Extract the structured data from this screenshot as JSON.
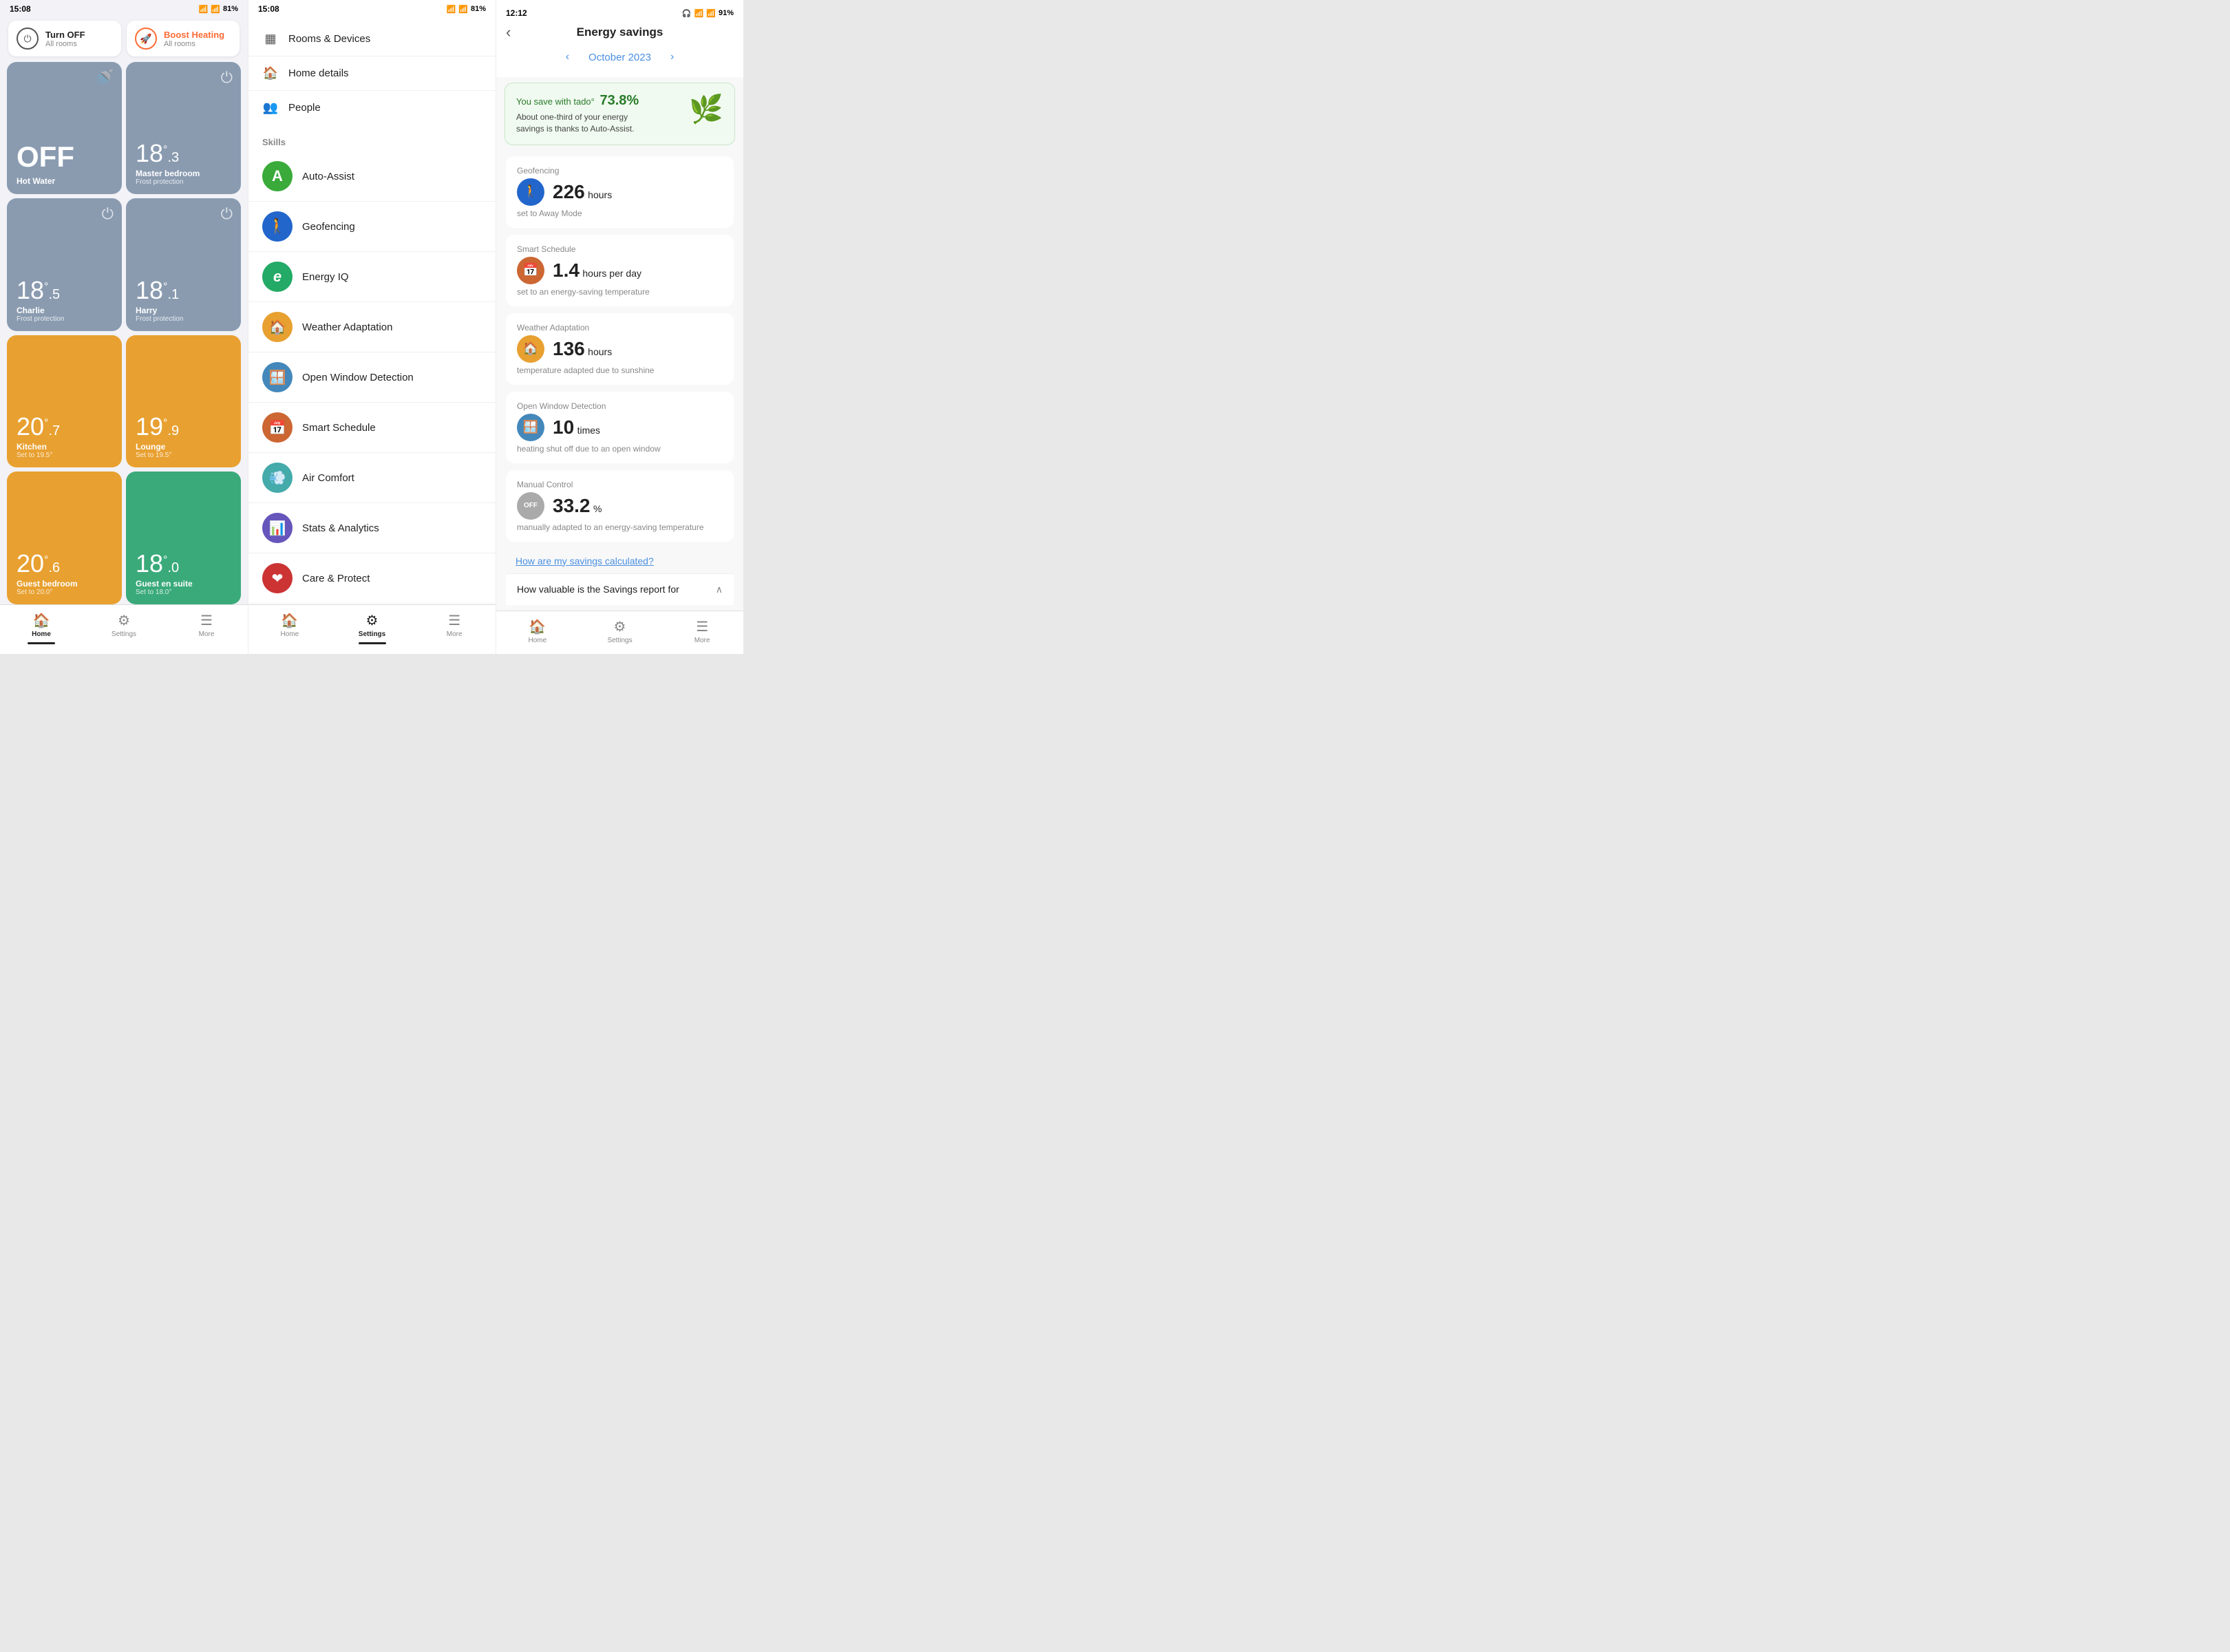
{
  "phone1": {
    "status_time": "15:08",
    "status_battery": "81%",
    "actions": [
      {
        "id": "turn-off",
        "label": "Turn OFF",
        "sub": "All rooms",
        "type": "normal"
      },
      {
        "id": "boost",
        "label": "Boost Heating",
        "sub": "All rooms",
        "type": "boost"
      }
    ],
    "rooms": [
      {
        "id": "hot-water",
        "name": "Hot Water",
        "sub": "",
        "display": "OFF",
        "type": "off",
        "color": "gray",
        "icon": "🚿"
      },
      {
        "id": "master-bedroom",
        "name": "Master bedroom",
        "sub": "Frost protection",
        "temp_main": "18",
        "temp_dec": ".3",
        "color": "gray",
        "icon": "⏻"
      },
      {
        "id": "charlie",
        "name": "Charlie",
        "sub": "Frost protection",
        "temp_main": "18",
        "temp_dec": ".5",
        "color": "gray",
        "icon": "⏻"
      },
      {
        "id": "harry",
        "name": "Harry",
        "sub": "Frost protection",
        "temp_main": "18",
        "temp_dec": ".1",
        "color": "gray",
        "icon": "⏻"
      },
      {
        "id": "kitchen",
        "name": "Kitchen",
        "sub": "Set to 19.5°",
        "temp_main": "20",
        "temp_dec": ".7",
        "color": "orange",
        "icon": ""
      },
      {
        "id": "lounge",
        "name": "Lounge",
        "sub": "Set to 19.5°",
        "temp_main": "19",
        "temp_dec": ".9",
        "color": "orange",
        "icon": ""
      },
      {
        "id": "guest-bedroom",
        "name": "Guest bedroom",
        "sub": "Set to 20.0°",
        "temp_main": "20",
        "temp_dec": ".6",
        "color": "orange",
        "icon": ""
      },
      {
        "id": "guest-ensuite",
        "name": "Guest en suite",
        "sub": "Set to 18.0°",
        "temp_main": "18",
        "temp_dec": ".0",
        "color": "green",
        "icon": ""
      }
    ],
    "nav": [
      {
        "id": "home",
        "label": "Home",
        "icon": "🏠",
        "active": true
      },
      {
        "id": "settings",
        "label": "Settings",
        "icon": "⚙",
        "active": false
      },
      {
        "id": "more",
        "label": "More",
        "icon": "☰",
        "active": false
      }
    ]
  },
  "phone2": {
    "status_time": "15:08",
    "status_battery": "81%",
    "menu_items": [
      {
        "id": "rooms-devices",
        "label": "Rooms & Devices",
        "icon": "▦"
      },
      {
        "id": "home-details",
        "label": "Home details",
        "icon": "🏠"
      },
      {
        "id": "people",
        "label": "People",
        "icon": "👥"
      }
    ],
    "skills_header": "Skills",
    "skills": [
      {
        "id": "auto-assist",
        "label": "Auto-Assist",
        "icon": "A",
        "color": "#3aaa3a"
      },
      {
        "id": "geofencing",
        "label": "Geofencing",
        "icon": "🚶",
        "color": "#2266cc"
      },
      {
        "id": "energy-iq",
        "label": "Energy IQ",
        "icon": "e",
        "color": "#22aa66"
      },
      {
        "id": "weather-adaptation",
        "label": "Weather Adaptation",
        "icon": "🏠",
        "color": "#e8a030"
      },
      {
        "id": "open-window",
        "label": "Open Window Detection",
        "icon": "⬛",
        "color": "#4488bb"
      },
      {
        "id": "smart-schedule",
        "label": "Smart Schedule",
        "icon": "📅",
        "color": "#cc6633"
      },
      {
        "id": "air-comfort",
        "label": "Air Comfort",
        "icon": "💨",
        "color": "#44aaaa"
      },
      {
        "id": "stats-analytics",
        "label": "Stats & Analytics",
        "icon": "📊",
        "color": "#6655bb"
      },
      {
        "id": "care-protect",
        "label": "Care & Protect",
        "icon": "❤",
        "color": "#cc3333"
      }
    ],
    "nav": [
      {
        "id": "home",
        "label": "Home",
        "icon": "🏠",
        "active": false
      },
      {
        "id": "settings",
        "label": "Settings",
        "icon": "⚙",
        "active": true
      },
      {
        "id": "more",
        "label": "More",
        "icon": "☰",
        "active": false
      }
    ]
  },
  "phone3": {
    "status_time": "12:12",
    "status_battery": "91%",
    "back_label": "‹",
    "title": "Energy savings",
    "month": "October 2023",
    "savings_banner": {
      "prefix": "You save with tado°",
      "percent": "73.8%",
      "desc": "About one-third of your energy savings is thanks to Auto-Assist.",
      "icon": "🌿"
    },
    "stats": [
      {
        "id": "geofencing",
        "header": "Geofencing",
        "value": "226",
        "unit": "hours",
        "desc": "set to Away Mode",
        "icon": "🚶",
        "icon_bg": "#2266cc"
      },
      {
        "id": "smart-schedule",
        "header": "Smart Schedule",
        "value": "1.4",
        "unit": "hours per day",
        "desc": "set to an energy-saving temperature",
        "icon": "📅",
        "icon_bg": "#cc6633"
      },
      {
        "id": "weather-adaptation",
        "header": "Weather Adaptation",
        "value": "136",
        "unit": "hours",
        "desc": "temperature adapted due to sunshine",
        "icon": "🏠",
        "icon_bg": "#e8a030"
      },
      {
        "id": "open-window",
        "header": "Open Window Detection",
        "value": "10",
        "unit": "times",
        "desc": "heating shut off due to an open window",
        "icon": "⬛",
        "icon_bg": "#4488bb"
      },
      {
        "id": "manual-control",
        "header": "Manual Control",
        "value": "33.2",
        "unit": "%",
        "desc": "manually adapted to an energy-saving temperature",
        "icon": "OFF",
        "icon_bg": "#aaaaaa"
      }
    ],
    "link": "How are my savings calculated?",
    "accordion": "How valuable is the Savings report for",
    "nav": [
      {
        "id": "home",
        "label": "Home",
        "icon": "🏠",
        "active": false
      },
      {
        "id": "settings",
        "label": "Settings",
        "icon": "⚙",
        "active": false
      },
      {
        "id": "more",
        "label": "More",
        "icon": "☰",
        "active": false
      }
    ]
  }
}
